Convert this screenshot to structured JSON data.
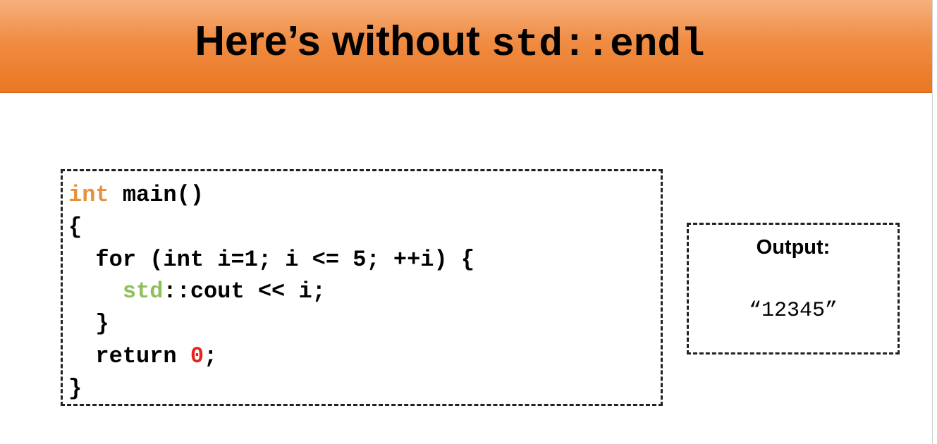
{
  "slide": {
    "title_prefix": "Here’s without ",
    "title_code": "std::endl"
  },
  "code": {
    "lines": [
      {
        "parts": [
          "int",
          " main()"
        ]
      },
      {
        "parts": [
          "{"
        ]
      },
      {
        "parts": [
          "  for (int i=1; i <= 5; ++i) {"
        ]
      },
      {
        "parts": [
          "    ",
          "std",
          "::cout << i;"
        ]
      },
      {
        "parts": [
          "  }"
        ]
      },
      {
        "parts": [
          "  return ",
          "0",
          ";"
        ]
      },
      {
        "parts": [
          "}"
        ]
      }
    ]
  },
  "output": {
    "label": "Output:",
    "value": "“12345”"
  },
  "colors": {
    "header_gradient_top": "#f6b07c",
    "header_gradient_bottom": "#e97722",
    "keyword_orange": "#e8913c",
    "namespace_green": "#8fbf5a",
    "number_red": "#e8231d"
  }
}
